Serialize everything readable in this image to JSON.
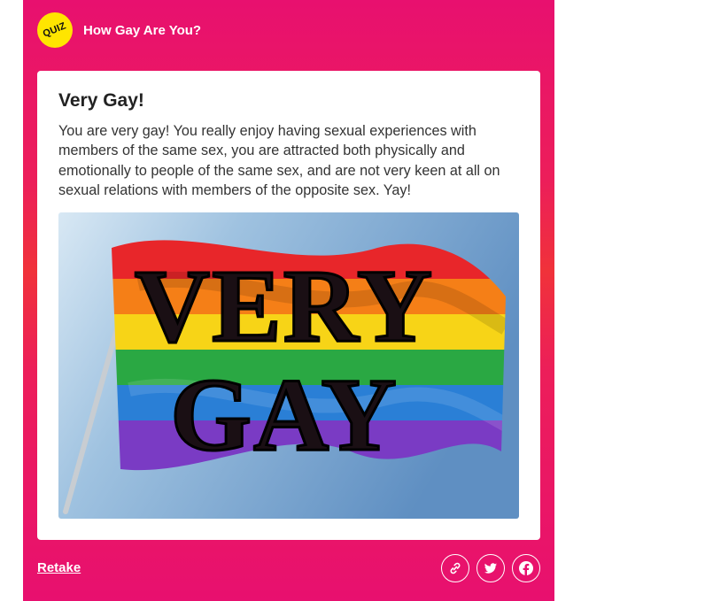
{
  "header": {
    "badge_text": "QUIZ",
    "title": "How Gay Are You?"
  },
  "result": {
    "title": "Very Gay!",
    "description": "You are very gay! You really enjoy having sexual experiences with members of the same sex, you are attracted both physically and emotionally to people of the same sex, and are not very keen at all on sexual relations with members of the opposite sex. Yay!",
    "image": {
      "text_line1": "VERY",
      "text_line2": "GAY"
    }
  },
  "footer": {
    "retake_label": "Retake",
    "share_icons": [
      "link-icon",
      "twitter-icon",
      "facebook-icon"
    ]
  },
  "colors": {
    "brand_pink": "#e8106f",
    "brand_red": "#f0323a",
    "badge_yellow": "#ffe500"
  }
}
